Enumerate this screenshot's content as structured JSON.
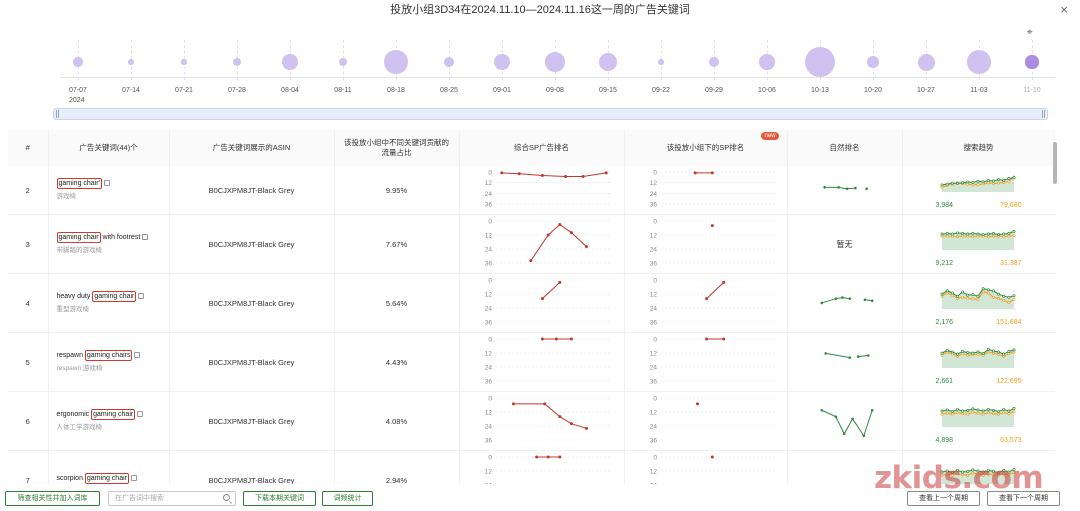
{
  "dialog": {
    "title": "投放小组3D34在2024.11.10—2024.11.16这一周的广告关键词",
    "close_icon": "×"
  },
  "timeline": {
    "year": "2024",
    "weeks": [
      {
        "label": "07-07",
        "volume": 0.2
      },
      {
        "label": "07-14",
        "volume": 0.05
      },
      {
        "label": "07-21",
        "volume": 0.05
      },
      {
        "label": "07-28",
        "volume": 0.15
      },
      {
        "label": "08-04",
        "volume": 0.45
      },
      {
        "label": "08-11",
        "volume": 0.15
      },
      {
        "label": "08-18",
        "volume": 0.75
      },
      {
        "label": "08-25",
        "volume": 0.25
      },
      {
        "label": "09-01",
        "volume": 0.45
      },
      {
        "label": "09-08",
        "volume": 0.6
      },
      {
        "label": "09-15",
        "volume": 0.55
      },
      {
        "label": "09-22",
        "volume": 0.05
      },
      {
        "label": "09-29",
        "volume": 0.25
      },
      {
        "label": "10-06",
        "volume": 0.45
      },
      {
        "label": "10-13",
        "volume": 1.0
      },
      {
        "label": "10-20",
        "volume": 0.3
      },
      {
        "label": "10-27",
        "volume": 0.5
      },
      {
        "label": "11-03",
        "volume": 0.75
      },
      {
        "label": "11-10",
        "volume": 0.35
      }
    ],
    "active_week": "11-10"
  },
  "table": {
    "headers": {
      "index": "#",
      "keyword": "广告关键词(44)个",
      "asin": "广告关键词展示的ASIN",
      "share": "该投放小组中不同关键词贡献的流量占比",
      "sp_rank": "综合SP广告排名",
      "group_sp_rank": "该投放小组下的SP排名",
      "new_badge": "new",
      "organic": "自然排名",
      "trend": "搜索趋势"
    },
    "rank_ticks": [
      "0",
      "12",
      "24",
      "36"
    ],
    "rows": [
      {
        "index": "2",
        "kw_highlight": "gaming chair'",
        "kw_rest": "",
        "kw_sub": "游戏椅",
        "asin": "B0CJXPM8JT-Black Grey",
        "share": "9.95%",
        "sp": [
          1,
          2,
          4,
          5,
          5,
          1
        ],
        "sp_x": [
          0.05,
          0.2,
          0.4,
          0.6,
          0.75,
          0.95
        ],
        "gsp": [
          1,
          1
        ],
        "gsp_x": [
          0.3,
          0.45
        ],
        "organic": [
          10,
          10,
          12,
          11,
          12
        ],
        "organic_x": [
          0.1,
          0.35,
          0.5,
          0.65,
          0.85
        ],
        "organic_gap": 3,
        "organic_text": "",
        "trend_green": "3,984",
        "trend_orange": "79,680",
        "g": [
          20,
          22,
          25,
          24,
          26,
          28,
          27,
          30,
          29,
          32,
          31,
          35,
          33,
          38,
          40
        ],
        "o": [
          14,
          18,
          22,
          26,
          24,
          22,
          20,
          21,
          23,
          26,
          24,
          25,
          27,
          30,
          42
        ]
      },
      {
        "index": "3",
        "kw_highlight": "gaming chair",
        "kw_rest": " with footrest",
        "kw_sub": "带脚踏的游戏椅",
        "asin": "B0CJXPM8JT-Black Grey",
        "share": "7.67%",
        "sp": [
          34,
          12,
          3,
          10,
          22
        ],
        "sp_x": [
          0.3,
          0.45,
          0.55,
          0.65,
          0.78
        ],
        "gsp": [
          4
        ],
        "gsp_x": [
          0.45
        ],
        "organic": [],
        "organic_x": [],
        "organic_gap": -1,
        "organic_text": "暂无",
        "trend_green": "9,212",
        "trend_orange": "31,387",
        "g": [
          30,
          31,
          30,
          32,
          31,
          30,
          31,
          30,
          29,
          30,
          31,
          29,
          30,
          31,
          35
        ],
        "o": [
          26,
          26,
          26,
          25,
          26,
          26,
          25,
          26,
          26,
          25,
          26,
          26,
          25,
          26,
          27
        ]
      },
      {
        "index": "4",
        "kw_highlight": "gaming chair",
        "kw_prefix": "heavy duty ",
        "kw_rest": "",
        "kw_sub": "重型游戏椅",
        "asin": "B0CJXPM8JT-Black Grey",
        "share": "5.64%",
        "sp": [
          16,
          2
        ],
        "sp_x": [
          0.4,
          0.55
        ],
        "gsp": [
          16,
          2
        ],
        "gsp_x": [
          0.4,
          0.55
        ],
        "organic": [
          14,
          10,
          9,
          10,
          11,
          12
        ],
        "organic_x": [
          0.05,
          0.3,
          0.42,
          0.55,
          0.82,
          0.95
        ],
        "organic_gap": 3,
        "organic_text": "",
        "trend_green": "2,176",
        "trend_orange": "151,684",
        "g": [
          28,
          34,
          30,
          24,
          32,
          26,
          27,
          24,
          38,
          36,
          34,
          28,
          24,
          22,
          25
        ],
        "o": [
          24,
          30,
          26,
          20,
          22,
          20,
          19,
          18,
          32,
          30,
          22,
          20,
          16,
          12,
          18
        ]
      },
      {
        "index": "5",
        "kw_highlight": "gaming chairs",
        "kw_prefix": "respawn ",
        "kw_rest": "",
        "kw_sub": "respawn 游戏椅",
        "asin": "B0CJXPM8JT-Black Grey",
        "share": "4.43%",
        "sp": [
          0,
          0,
          0
        ],
        "sp_x": [
          0.4,
          0.52,
          0.65
        ],
        "gsp": [
          0,
          0
        ],
        "gsp_x": [
          0.4,
          0.55
        ],
        "organic": [
          6,
          10,
          9,
          8
        ],
        "organic_x": [
          0.12,
          0.55,
          0.7,
          0.88
        ],
        "organic_gap": 1,
        "organic_text": "",
        "trend_green": "2,661",
        "trend_orange": "122,695",
        "g": [
          28,
          33,
          30,
          26,
          31,
          29,
          28,
          30,
          27,
          35,
          32,
          30,
          26,
          31,
          34
        ],
        "o": [
          24,
          30,
          26,
          22,
          27,
          24,
          25,
          26,
          24,
          30,
          28,
          25,
          22,
          27,
          30
        ]
      },
      {
        "index": "6",
        "kw_highlight": "gaming chair",
        "kw_prefix": "ergonomic ",
        "kw_rest": "",
        "kw_sub": "人体工学游戏椅",
        "asin": "B0CJXPM8JT-Black Grey",
        "share": "4.08%",
        "sp": [
          5,
          5,
          16,
          22,
          26
        ],
        "sp_x": [
          0.15,
          0.42,
          0.55,
          0.65,
          0.78
        ],
        "gsp": [
          5
        ],
        "gsp_x": [
          0.32
        ],
        "organic": [
          4,
          10,
          26,
          12,
          28,
          4
        ],
        "organic_x": [
          0.05,
          0.3,
          0.45,
          0.6,
          0.8,
          0.95
        ],
        "organic_gap": -1,
        "organic_text": "",
        "trend_green": "4,898",
        "trend_orange": "63,573",
        "g": [
          30,
          32,
          29,
          33,
          30,
          31,
          34,
          32,
          30,
          33,
          31,
          29,
          33,
          30,
          35
        ],
        "o": [
          24,
          26,
          24,
          27,
          25,
          24,
          28,
          26,
          24,
          27,
          25,
          24,
          27,
          25,
          29
        ]
      },
      {
        "index": "7",
        "kw_highlight": "gaming chair",
        "kw_prefix": "scorpion ",
        "kw_rest": "",
        "kw_sub": "",
        "asin": "B0CJXPM8JT-Black Grey",
        "share": "2.94%",
        "sp": [
          0,
          0,
          0
        ],
        "sp_x": [
          0.35,
          0.45,
          0.55
        ],
        "gsp": [
          0
        ],
        "gsp_x": [
          0.45
        ],
        "organic": [],
        "organic_x": [],
        "organic_gap": -1,
        "organic_text": "",
        "trend_green": "",
        "trend_orange": "",
        "g": [
          30,
          32,
          29,
          33,
          30,
          31,
          34,
          32,
          30,
          33,
          31,
          29,
          33,
          30,
          35
        ],
        "o": [
          24,
          26,
          24,
          27,
          25,
          24,
          28,
          26,
          24,
          27,
          25,
          24,
          27,
          25,
          29
        ]
      }
    ]
  },
  "bottom": {
    "filter_button": "筛查相关性并加入词库",
    "search_placeholder": "在广告词中搜索",
    "download_button": "下载本期关键词",
    "stats_button": "词频统计",
    "prev_week_button": "查看上一个周期",
    "next_week_button": "查看下一个周期"
  },
  "watermark": "zkids.com",
  "colors": {
    "green": "#2e8b3e",
    "orange": "#f0a020",
    "red": "#c0392b",
    "bubble": "#cfc2f0",
    "bubble_active": "#a98de3",
    "highlight_border": "#d33a2c"
  }
}
